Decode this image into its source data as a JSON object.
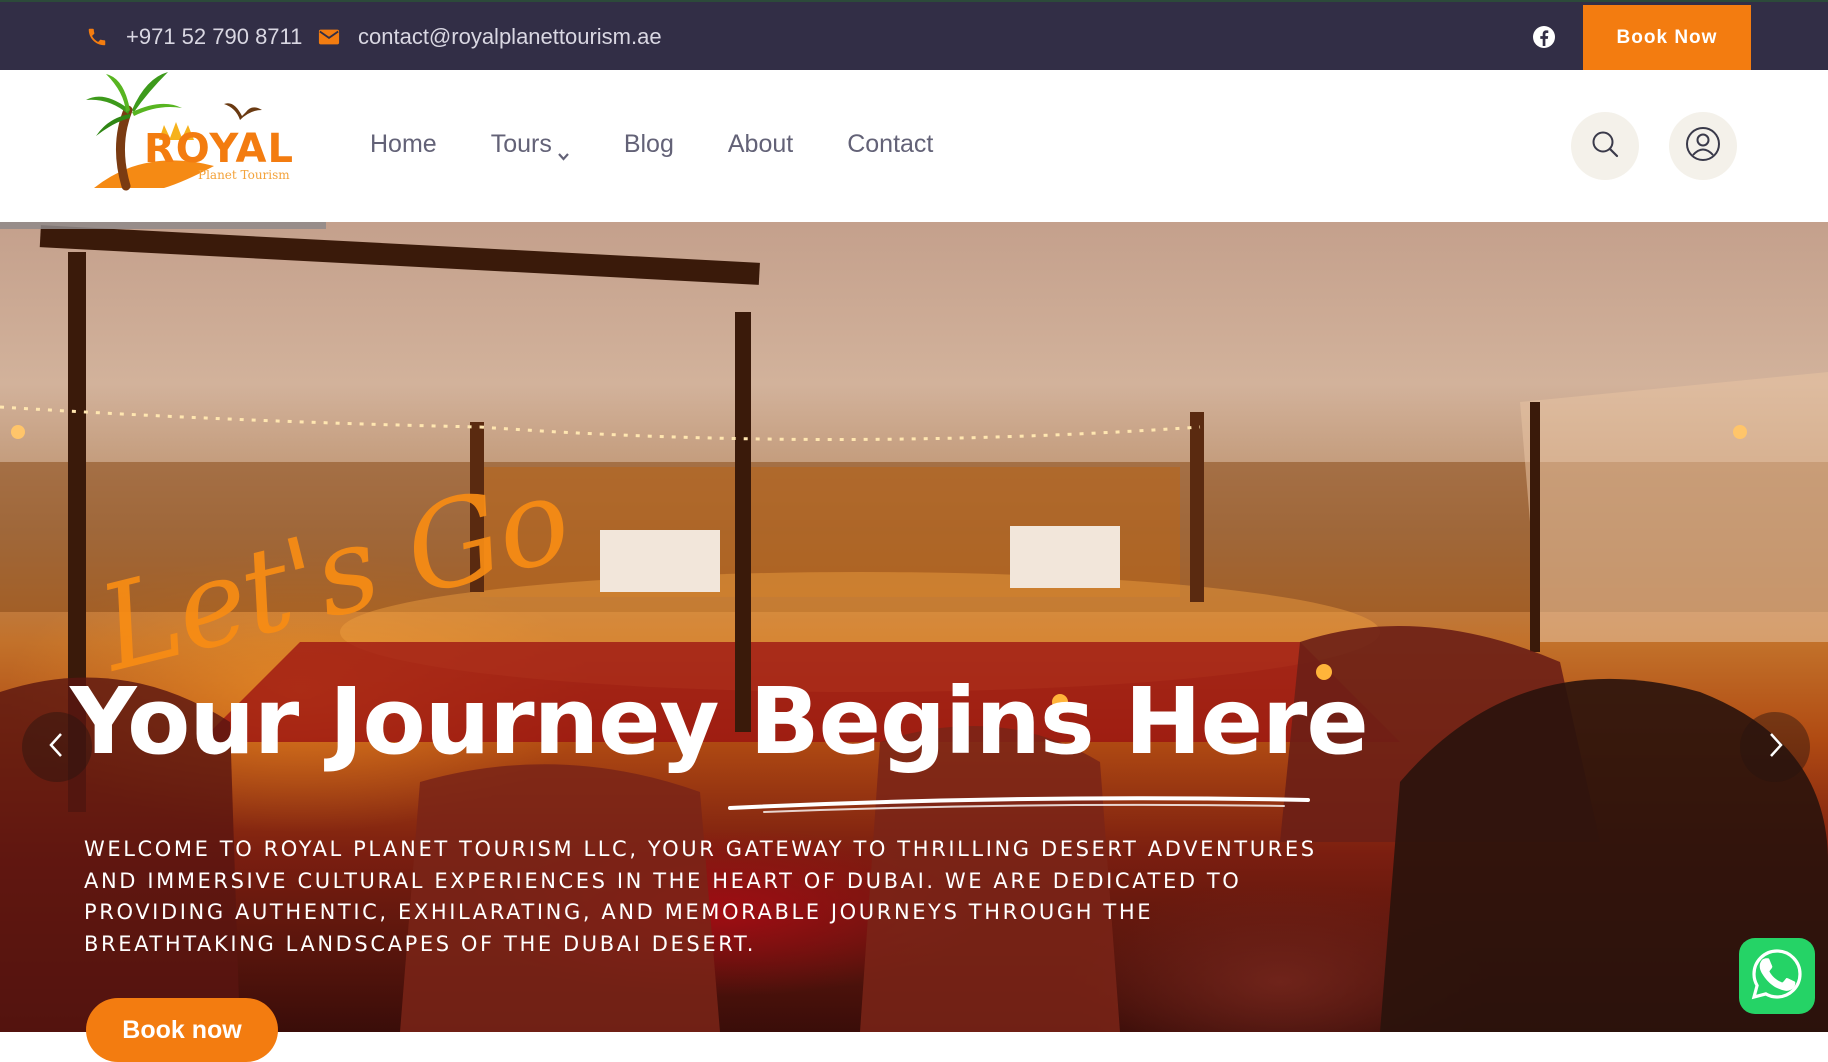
{
  "topbar": {
    "phone": "+971 52 790 8711",
    "email": "contact@royalplanettourism.ae",
    "book_now_label": "Book Now",
    "social_icon": "facebook-icon"
  },
  "logo": {
    "tagline": "Planet Tourism"
  },
  "nav": {
    "items": [
      {
        "label": "Home"
      },
      {
        "label": "Tours"
      },
      {
        "label": "Blog"
      },
      {
        "label": "About"
      },
      {
        "label": "Contact"
      }
    ]
  },
  "hero": {
    "script_text": "Let's Go",
    "title": "Your Journey Begins Here",
    "description": "Welcome to Royal Planet Tourism LLC, your gateway to thrilling desert adventures and immersive cultural experiences in the heart of Dubai. We are dedicated to providing authentic, exhilarating, and memorable journeys through the breathtaking landscapes of the Dubai desert.",
    "button_label": "Book now"
  },
  "colors": {
    "accent": "#f37c10",
    "topbar_bg": "#322e46",
    "whatsapp": "#25d366"
  }
}
